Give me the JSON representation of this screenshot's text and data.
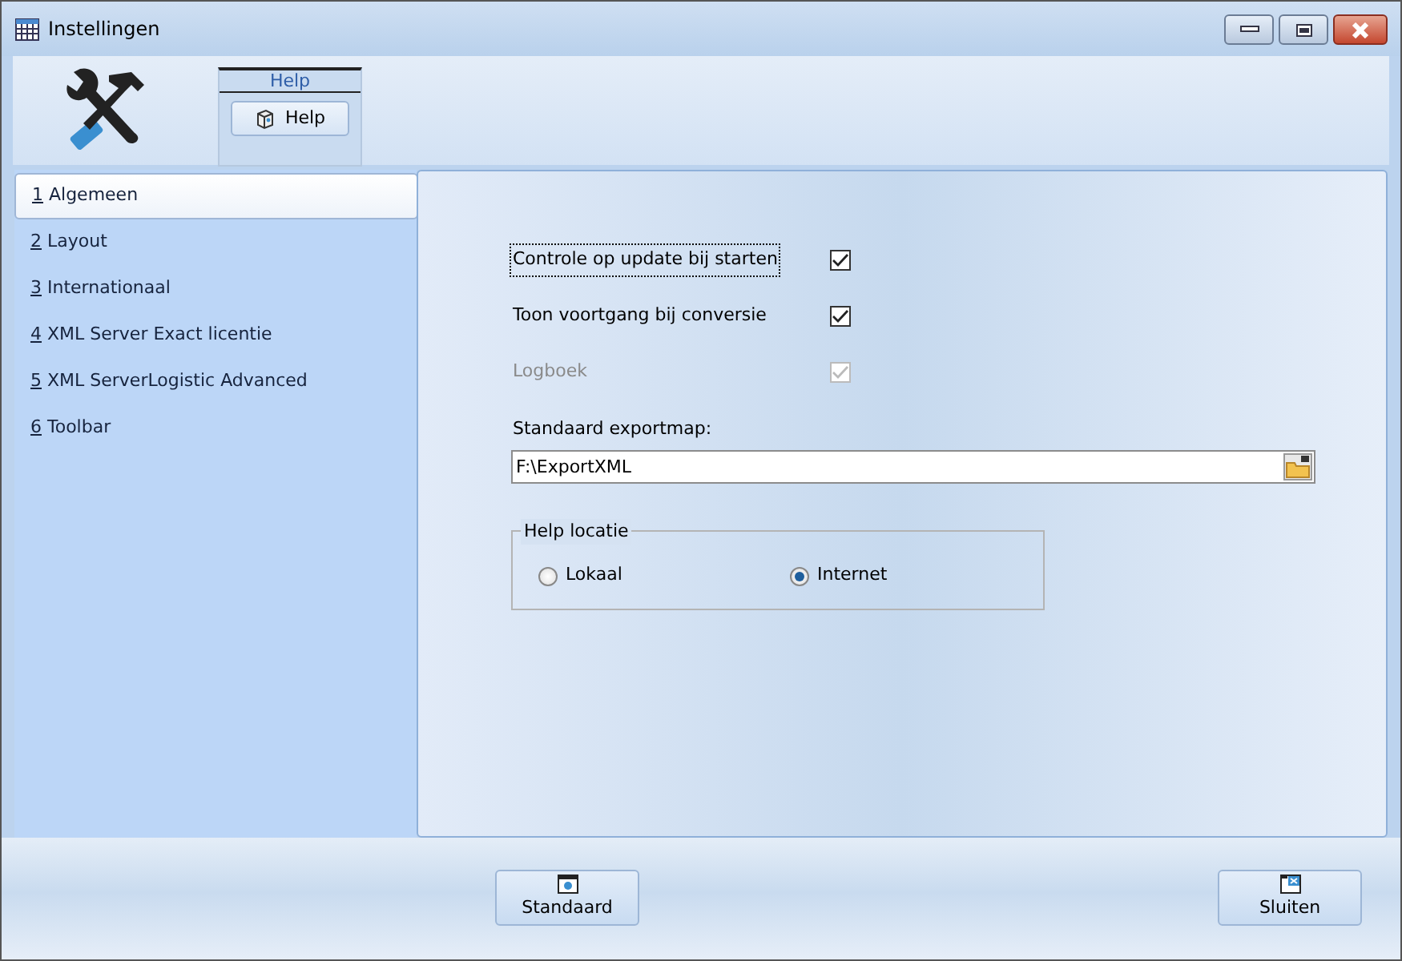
{
  "window": {
    "title": "Instellingen"
  },
  "ribbon": {
    "group_title": "Help",
    "button": "Help"
  },
  "nav": [
    {
      "key": "1",
      "label": "Algemeen",
      "selected": true
    },
    {
      "key": "2",
      "label": "Layout",
      "selected": false
    },
    {
      "key": "3",
      "label": "Internationaal",
      "selected": false
    },
    {
      "key": "4",
      "label": "XML Server Exact licentie",
      "selected": false
    },
    {
      "key": "5",
      "label": "XML ServerLogistic Advanced",
      "selected": false
    },
    {
      "key": "6",
      "label": "Toolbar",
      "selected": false
    }
  ],
  "options": [
    {
      "label": "Controle op update bij starten",
      "checked": true,
      "disabled": false,
      "focused": true
    },
    {
      "label": "Toon voortgang bij conversie",
      "checked": true,
      "disabled": false,
      "focused": false
    },
    {
      "label": "Logboek",
      "checked": true,
      "disabled": true,
      "focused": false
    }
  ],
  "export": {
    "label": "Standaard exportmap:",
    "value": "F:\\ExportXML"
  },
  "help_location": {
    "title": "Help locatie",
    "options": [
      {
        "label": "Lokaal",
        "selected": false
      },
      {
        "label": "Internet",
        "selected": true
      }
    ]
  },
  "buttons": [
    {
      "kind": "default",
      "label": "Standaard"
    },
    {
      "kind": "close",
      "label": "Sluiten"
    }
  ]
}
